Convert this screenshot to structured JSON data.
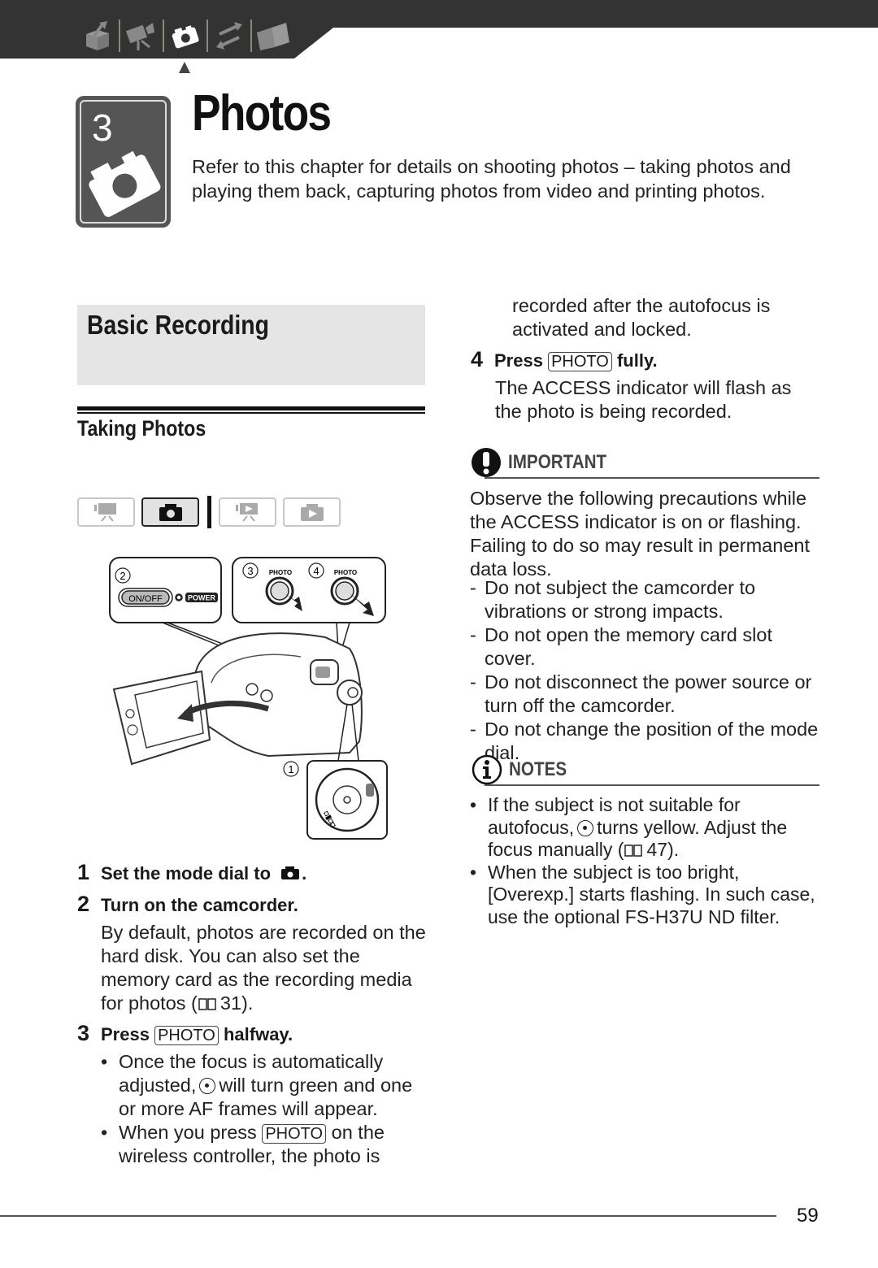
{
  "nav": {
    "icons": [
      "getting-started-icon",
      "video-icon",
      "photo-icon",
      "external-connections-icon",
      "additional-info-icon"
    ],
    "active_index": 2
  },
  "chapter": {
    "number": "3",
    "title": "Photos",
    "intro": "Refer to this chapter for details on shooting photos – taking photos and playing them back, capturing photos from video and printing photos."
  },
  "section": {
    "title": "Basic Recording",
    "subtitle": "Taking Photos"
  },
  "mode_buttons": [
    {
      "name": "video-record-mode",
      "active": false
    },
    {
      "name": "photo-record-mode",
      "active": true
    },
    {
      "name": "video-playback-mode",
      "active": false
    },
    {
      "name": "photo-playback-mode",
      "active": false
    }
  ],
  "illustration": {
    "callout_2": "2",
    "callout_3": "3",
    "callout_4": "4",
    "callout_1": "1",
    "onoff_label": "ON/OFF",
    "power_label": "POWER",
    "photo_label": "PHOTO"
  },
  "steps": {
    "s1": {
      "num": "1",
      "text": "Set the mode dial to",
      "suffix": "."
    },
    "s2": {
      "num": "2",
      "text": "Turn on the camcorder.",
      "body": "By default, photos are recorded on the hard disk. You can also set the memory card as the recording media for photos (",
      "ref": "31",
      "close": ")."
    },
    "s3": {
      "num": "3",
      "press": "Press",
      "key": "PHOTO",
      "after": "halfway.",
      "b1_pre": "Once the focus is automatically adjusted,",
      "b1_post": "will turn green and one or more AF frames will appear.",
      "b2_pre": "When you press",
      "b2_key": "PHOTO",
      "b2_post": "on the wireless controller, the photo is",
      "b2_cont": "recorded after the autofocus is activated and locked."
    },
    "s4": {
      "num": "4",
      "press": "Press",
      "key": "PHOTO",
      "after": "fully.",
      "body": "The ACCESS indicator will flash as the photo is being recorded."
    }
  },
  "important": {
    "label": "IMPORTANT",
    "intro": "Observe the following precautions while the ACCESS indicator is on or flashing. Failing to do so may result in permanent data loss.",
    "items": [
      "Do not subject the camcorder to vibrations or strong impacts.",
      "Do not open the memory card slot cover.",
      "Do not disconnect the power source or turn off the camcorder.",
      "Do not change the position of the mode dial."
    ]
  },
  "notes": {
    "label": "NOTES",
    "n1_pre": "If the subject is not suitable for autofocus,",
    "n1_post": "turns yellow. Adjust the focus manually (",
    "n1_ref": "47",
    "n1_close": ").",
    "n2": "When the subject is too bright, [Overexp.] starts flashing. In such case, use the optional FS-H37U ND filter."
  },
  "footer": {
    "page_number": "59"
  },
  "colors": {
    "nav_bg": "#333333",
    "badge_bg": "#555555",
    "section_bg": "#e5e5e5"
  }
}
